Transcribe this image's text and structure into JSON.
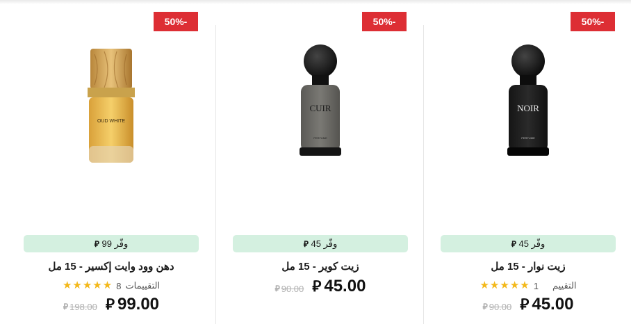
{
  "currency_symbol": "⃁",
  "products": [
    {
      "discount_badge": "50%-",
      "save_label": "وفّر 99",
      "name": "دهن وود وايت إكسير - 15 مل",
      "rating_label": "التقييمات",
      "rating_count": "8",
      "stars": 5,
      "price": "99.00",
      "old_price": "198.00",
      "image_icon": "oud-bottle-icon"
    },
    {
      "discount_badge": "50%-",
      "save_label": "وفّر 45",
      "name": "زيت كوير - 15 مل",
      "rating_label": "",
      "rating_count": "",
      "stars": 0,
      "price": "45.00",
      "old_price": "90.00",
      "image_icon": "cuir-bottle-icon",
      "bottle_text": "CUIR"
    },
    {
      "discount_badge": "50%-",
      "save_label": "وفّر 45",
      "name": "زيت نوار - 15 مل",
      "rating_label": "التقييم",
      "rating_count": "1",
      "stars": 5,
      "price": "45.00",
      "old_price": "90.00",
      "image_icon": "noir-bottle-icon",
      "bottle_text": "NOIR"
    }
  ],
  "colors": {
    "badge": "#dd2e34",
    "save_pill": "#d4f0e0",
    "star": "#f3b81a"
  }
}
